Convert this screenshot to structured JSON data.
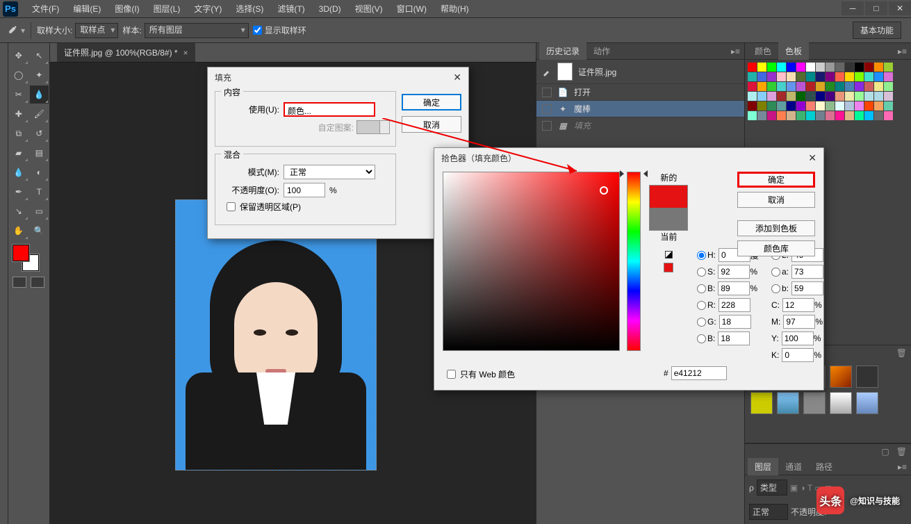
{
  "menu": {
    "items": [
      "文件(F)",
      "编辑(E)",
      "图像(I)",
      "图层(L)",
      "文字(Y)",
      "选择(S)",
      "滤镜(T)",
      "3D(D)",
      "视图(V)",
      "窗口(W)",
      "帮助(H)"
    ]
  },
  "optbar": {
    "sample_size_lbl": "取样大小:",
    "sample_size_val": "取样点",
    "sample_lbl": "样本:",
    "sample_val": "所有图层",
    "show_ring": "显示取样环",
    "mode_btn": "基本功能"
  },
  "doc": {
    "tab": "证件照.jpg @ 100%(RGB/8#) *"
  },
  "history": {
    "tabs": [
      "历史记录",
      "动作"
    ],
    "head": "证件照.jpg",
    "items": [
      {
        "label": "打开"
      },
      {
        "label": "魔棒"
      },
      {
        "label": "填充"
      }
    ]
  },
  "colorpanel": {
    "tabs": [
      "颜色",
      "色板"
    ]
  },
  "layerpanel": {
    "tabs": [
      "图层",
      "通道",
      "路径"
    ],
    "kind": "类型",
    "mode": "正常",
    "opacity_lbl": "不透明度:"
  },
  "fill": {
    "title": "填充",
    "content_legend": "内容",
    "use_lbl": "使用(U):",
    "use_val": "颜色...",
    "pattern_lbl": "自定图案:",
    "blend_legend": "混合",
    "mode_lbl": "模式(M):",
    "mode_val": "正常",
    "opacity_lbl": "不透明度(O):",
    "opacity_val": "100",
    "opacity_unit": "%",
    "preserve": "保留透明区域(P)",
    "ok": "确定",
    "cancel": "取消"
  },
  "picker": {
    "title": "拾色器（填充颜色）",
    "new_lbl": "新的",
    "cur_lbl": "当前",
    "ok": "确定",
    "cancel": "取消",
    "add": "添加到色板",
    "lib": "颜色库",
    "H": "H:",
    "H_v": "0",
    "H_u": "度",
    "S": "S:",
    "S_v": "92",
    "B": "B:",
    "B_v": "89",
    "L": "L:",
    "L_v": "49",
    "a": "a:",
    "a_v": "73",
    "b": "b:",
    "b_v": "59",
    "R": "R:",
    "R_v": "228",
    "G": "G:",
    "G_v": "18",
    "Bb": "B:",
    "Bb_v": "18",
    "C": "C:",
    "C_v": "12",
    "M": "M:",
    "M_v": "97",
    "Y": "Y:",
    "Y_v": "100",
    "K": "K:",
    "K_v": "0",
    "pct": "%",
    "web": "只有 Web 颜色",
    "hash": "#",
    "hex": "e41212"
  },
  "swatches": [
    "#ff0000",
    "#ffff00",
    "#00ff00",
    "#00ffff",
    "#0000ff",
    "#ff00ff",
    "#ffffff",
    "#cccccc",
    "#999999",
    "#666666",
    "#333333",
    "#000000",
    "#8b0000",
    "#ff8c00",
    "#9acd32",
    "#20b2aa",
    "#4169e1",
    "#9932cc",
    "#ffc0cb",
    "#f5deb3",
    "#556b2f",
    "#008b8b",
    "#191970",
    "#800080",
    "#ff6347",
    "#ffd700",
    "#7fff00",
    "#40e0d0",
    "#1e90ff",
    "#da70d6",
    "#dc143c",
    "#ffa500",
    "#32cd32",
    "#48d1cc",
    "#6495ed",
    "#ba55d3",
    "#b22222",
    "#daa520",
    "#228b22",
    "#008080",
    "#4682b4",
    "#8a2be2",
    "#cd5c5c",
    "#f0e68c",
    "#90ee90",
    "#afeeee",
    "#87cefa",
    "#dda0dd",
    "#a52a2a",
    "#bdb76b",
    "#006400",
    "#2f4f4f",
    "#000080",
    "#4b0082",
    "#e9967a",
    "#eee8aa",
    "#98fb98",
    "#b0e0e6",
    "#add8e6",
    "#d8bfd8",
    "#800000",
    "#808000",
    "#2e8b57",
    "#5f9ea0",
    "#00008b",
    "#9400d3",
    "#fa8072",
    "#fffacd",
    "#8fbc8f",
    "#e0ffff",
    "#b0c4de",
    "#ee82ee",
    "#ff4500",
    "#f4a460",
    "#66cdaa",
    "#7fffd4",
    "#778899",
    "#c71585",
    "#ff7f50",
    "#d2b48c",
    "#3cb371",
    "#00ced1",
    "#708090",
    "#db7093",
    "#ff1493",
    "#deb887",
    "#00fa9a",
    "#00bfff",
    "#696969",
    "#ff69b4"
  ],
  "watermark": {
    "brand": "头条",
    "text": "@知识与技能"
  }
}
